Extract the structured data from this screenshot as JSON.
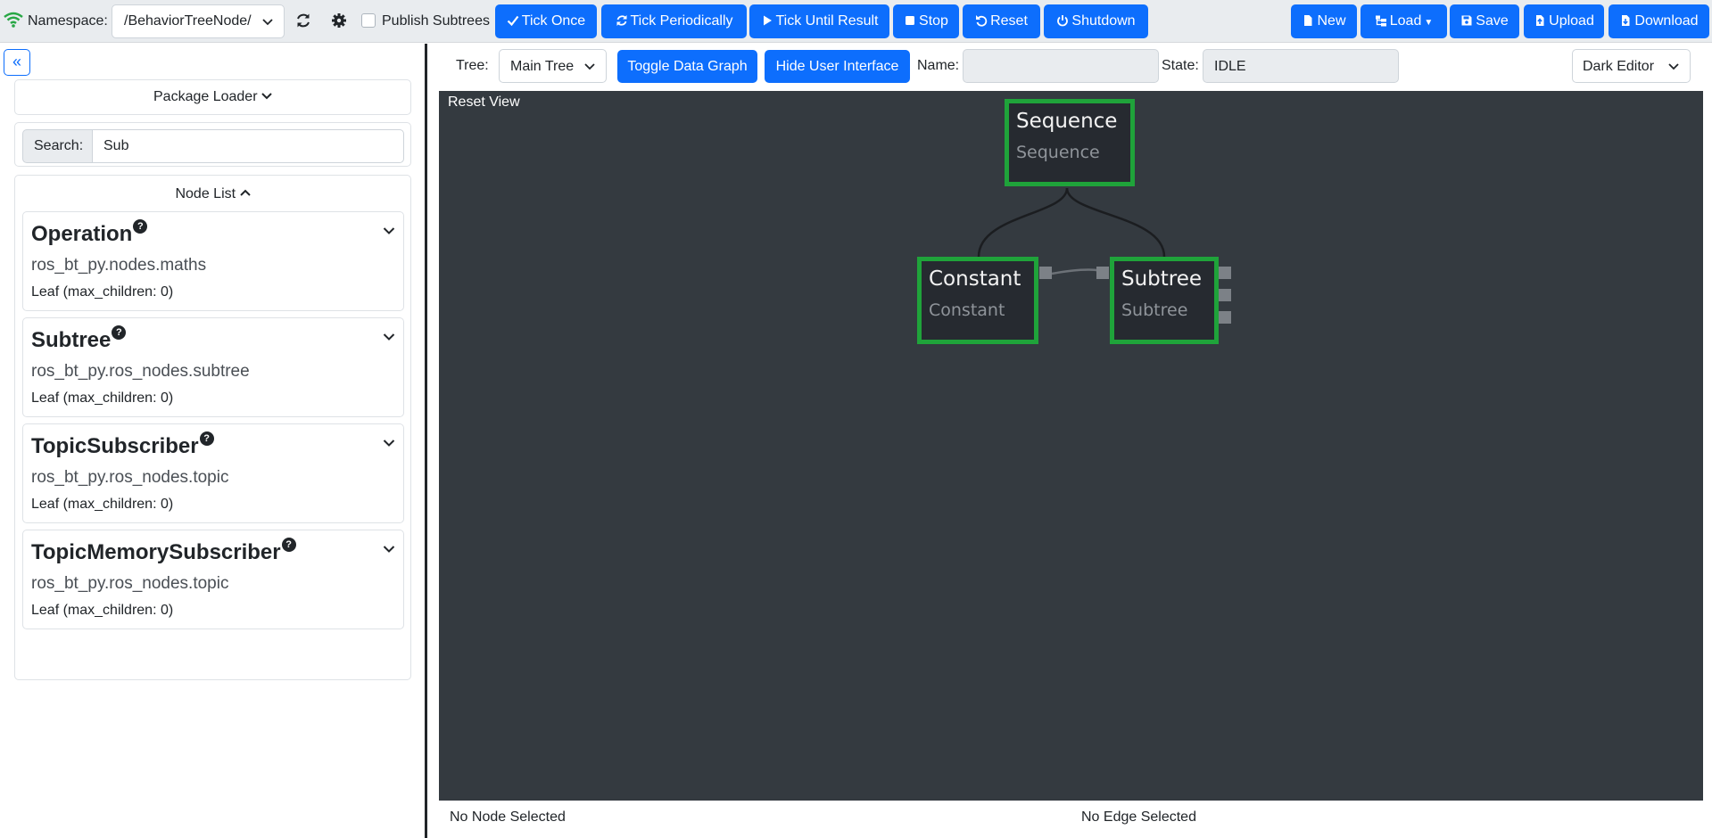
{
  "topbar": {
    "namespace_label": "Namespace:",
    "namespace_value": "/BehaviorTreeNode/",
    "publish_label": "Publish Subtrees",
    "tick_once": "Tick Once",
    "tick_periodically": "Tick Periodically",
    "tick_until_result": "Tick Until Result",
    "stop": "Stop",
    "reset": "Reset",
    "shutdown": "Shutdown",
    "new": "New",
    "load": "Load",
    "save": "Save",
    "upload": "Upload",
    "download": "Download"
  },
  "left": {
    "package_loader": "Package Loader",
    "search_label": "Search:",
    "search_value": "Sub",
    "node_list_label": "Node List",
    "nodes": [
      {
        "name": "Operation",
        "module": "ros_bt_py.nodes.maths",
        "leaf": "Leaf (max_children: 0)"
      },
      {
        "name": "Subtree",
        "module": "ros_bt_py.ros_nodes.subtree",
        "leaf": "Leaf (max_children: 0)"
      },
      {
        "name": "TopicSubscriber",
        "module": "ros_bt_py.ros_nodes.topic",
        "leaf": "Leaf (max_children: 0)"
      },
      {
        "name": "TopicMemorySubscriber",
        "module": "ros_bt_py.ros_nodes.topic",
        "leaf": "Leaf (max_children: 0)"
      }
    ]
  },
  "editor": {
    "tree_label": "Tree:",
    "tree_value": "Main Tree",
    "toggle_data_graph": "Toggle Data Graph",
    "hide_ui": "Hide User Interface",
    "name_label": "Name:",
    "name_value": "",
    "state_label": "State:",
    "state_value": "IDLE",
    "theme_value": "Dark Editor",
    "reset_view": "Reset View",
    "tree_nodes": {
      "sequence": {
        "title": "Sequence",
        "type": "Sequence"
      },
      "constant": {
        "title": "Constant",
        "type": "Constant"
      },
      "subtree": {
        "title": "Subtree",
        "type": "Subtree"
      }
    },
    "no_node_selected": "No Node Selected",
    "no_edge_selected": "No Edge Selected"
  },
  "colors": {
    "accent": "#0d6efd",
    "node_border": "#1fa33a",
    "canvas_bg": "#343a40",
    "wifi": "#28a745"
  }
}
